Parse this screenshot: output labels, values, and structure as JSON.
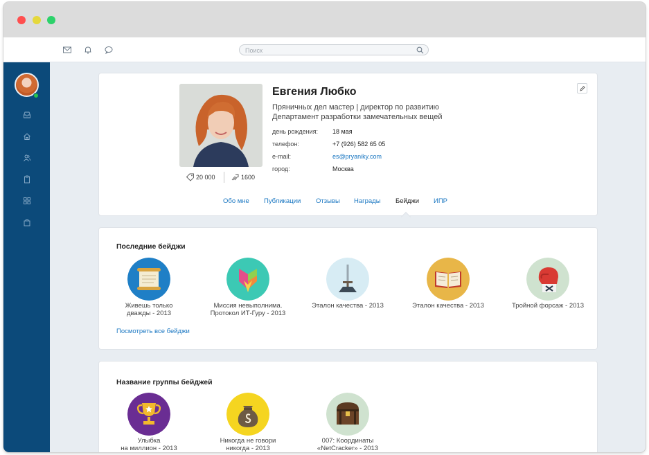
{
  "window": {
    "controls": [
      "close",
      "minimize",
      "maximize"
    ]
  },
  "topbar": {
    "icons": [
      "mail-icon",
      "bell-icon",
      "chat-icon"
    ],
    "search_placeholder": "Поиск"
  },
  "sidebar": {
    "icons": [
      "inbox-icon",
      "home-icon",
      "users-icon",
      "clipboard-icon",
      "grid-icon",
      "bag-icon"
    ],
    "online_color": "#27c24c"
  },
  "profile": {
    "name": "Евгения Любко",
    "position": "Пряничных дел мастер | директор по развитию",
    "department": "Департамент разработки замечательных вещей",
    "fields": [
      {
        "label": "день рождения:",
        "value": "18 мая"
      },
      {
        "label": "телефон:",
        "value": "+7 (926) 582 65 05"
      },
      {
        "label": "e-mail:",
        "value": "es@pryaniky.com"
      },
      {
        "label": "город:",
        "value": "Москва"
      }
    ],
    "stats": {
      "coins": "20 000",
      "thanks": "1600"
    }
  },
  "tabs": [
    {
      "label": "Обо мне",
      "active": false
    },
    {
      "label": "Публикации",
      "active": false
    },
    {
      "label": "Отзывы",
      "active": false
    },
    {
      "label": "Награды",
      "active": false
    },
    {
      "label": "Бейджи",
      "active": true
    },
    {
      "label": "ИПР",
      "active": false
    }
  ],
  "recent_badges": {
    "title": "Последние бейджи",
    "see_all": "Посмотреть все бейджи",
    "items": [
      {
        "caption": "Живешь только\nдважды - 2013",
        "icon": "scroll-icon",
        "color": "#1f7fc6"
      },
      {
        "caption": "Миссия невыполнима.\nПротокол ИТ-Гуру - 2013",
        "icon": "mask-icon",
        "color": "#3cc9b4"
      },
      {
        "caption": "Эталон качества - 2013",
        "icon": "sword-icon",
        "color": "#d7ecf4"
      },
      {
        "caption": "Эталон качества - 2013",
        "icon": "book-icon",
        "color": "#e8b648"
      },
      {
        "caption": "Тройной форсаж - 2013",
        "icon": "boxing-glove-icon",
        "color": "#cfe2cf"
      }
    ]
  },
  "group_badges": {
    "title": "Название группы бейджей",
    "items": [
      {
        "caption": "Улыбка\nна миллион - 2013",
        "icon": "trophy-icon",
        "color": "#6a2d93"
      },
      {
        "caption": "Никогда не говори\nникогда - 2013",
        "icon": "money-bag-icon",
        "color": "#f5d520"
      },
      {
        "caption": "007: Координаты\n«NetCracker» - 2013",
        "icon": "treasure-chest-icon",
        "color": "#cfe2cf"
      }
    ]
  }
}
